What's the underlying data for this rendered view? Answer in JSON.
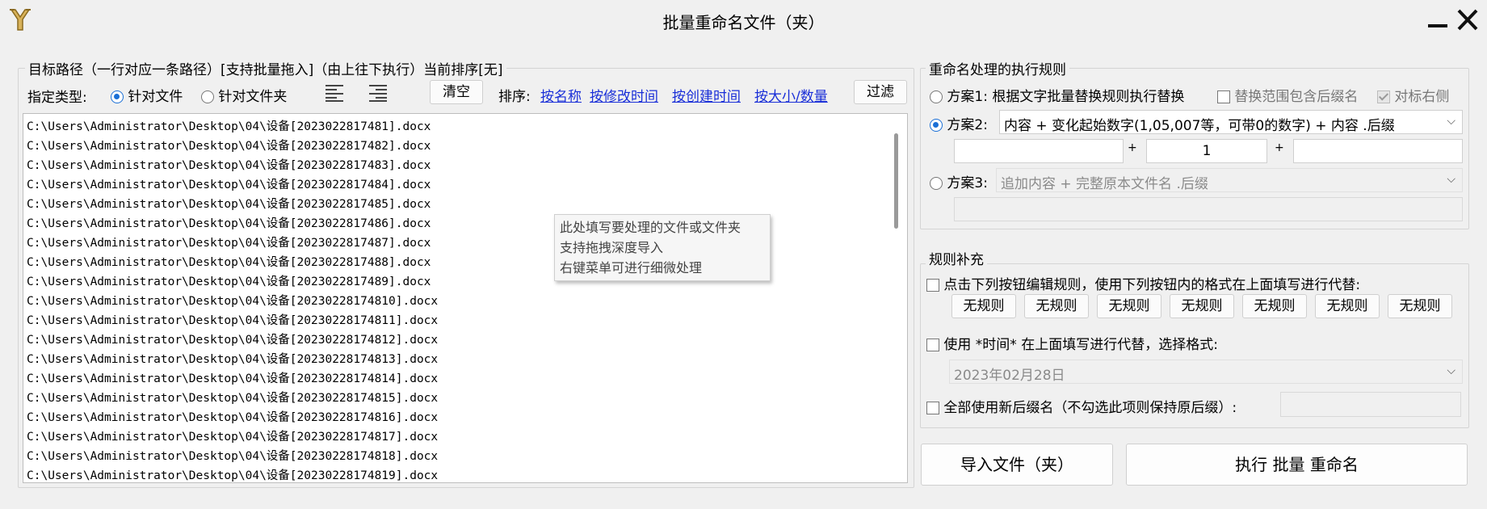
{
  "window": {
    "title": "批量重命名文件（夹）",
    "minimize_glyph": "—",
    "close_glyph": "✕"
  },
  "targets": {
    "legend": "目标路径（一行对应一条路径）[支持批量拖入]（由上往下执行）当前排序[无]",
    "type_label": "指定类型:",
    "type_file": "针对文件",
    "type_folder": "针对文件夹",
    "clear_button": "清空",
    "sort_label": "排序:",
    "sort_links": [
      "按名称",
      "按修改时间",
      "按创建时间",
      "按大小/数量"
    ],
    "filter_button": "过滤",
    "paths": [
      "C:\\Users\\Administrator\\Desktop\\04\\设备[2023022817481].docx",
      "C:\\Users\\Administrator\\Desktop\\04\\设备[2023022817482].docx",
      "C:\\Users\\Administrator\\Desktop\\04\\设备[2023022817483].docx",
      "C:\\Users\\Administrator\\Desktop\\04\\设备[2023022817484].docx",
      "C:\\Users\\Administrator\\Desktop\\04\\设备[2023022817485].docx",
      "C:\\Users\\Administrator\\Desktop\\04\\设备[2023022817486].docx",
      "C:\\Users\\Administrator\\Desktop\\04\\设备[2023022817487].docx",
      "C:\\Users\\Administrator\\Desktop\\04\\设备[2023022817488].docx",
      "C:\\Users\\Administrator\\Desktop\\04\\设备[2023022817489].docx",
      "C:\\Users\\Administrator\\Desktop\\04\\设备[20230228174810].docx",
      "C:\\Users\\Administrator\\Desktop\\04\\设备[20230228174811].docx",
      "C:\\Users\\Administrator\\Desktop\\04\\设备[20230228174812].docx",
      "C:\\Users\\Administrator\\Desktop\\04\\设备[20230228174813].docx",
      "C:\\Users\\Administrator\\Desktop\\04\\设备[20230228174814].docx",
      "C:\\Users\\Administrator\\Desktop\\04\\设备[20230228174815].docx",
      "C:\\Users\\Administrator\\Desktop\\04\\设备[20230228174816].docx",
      "C:\\Users\\Administrator\\Desktop\\04\\设备[20230228174817].docx",
      "C:\\Users\\Administrator\\Desktop\\04\\设备[20230228174818].docx",
      "C:\\Users\\Administrator\\Desktop\\04\\设备[20230228174819].docx"
    ],
    "tooltip_lines": [
      "此处填写要处理的文件或文件夹",
      "支持拖拽深度导入",
      "右键菜单可进行细微处理"
    ]
  },
  "rules": {
    "legend": "重命名处理的执行规则",
    "scheme1_label": "方案1: 根据文字批量替换规则执行替换",
    "scheme1_include_ext": "替换范围包含后缀名",
    "scheme1_align_right": "对标右侧",
    "scheme2_label": "方案2:",
    "scheme2_selected": "内容 + 变化起始数字(1,05,007等，可带0的数字) + 内容 .后缀",
    "scheme2_prefix": "",
    "scheme2_plus": "+",
    "scheme2_start_number": "1",
    "scheme2_suffix": "",
    "scheme3_label": "方案3:",
    "scheme3_selected": "追加内容 + 完整原本文件名 .后缀",
    "scheme3_value": ""
  },
  "supplement": {
    "legend": "规则补充",
    "edit_rules_label": "点击下列按钮编辑规则，使用下列按钮内的格式在上面填写进行代替:",
    "rule_buttons": [
      "无规则",
      "无规则",
      "无规则",
      "无规则",
      "无规则",
      "无规则",
      "无规则"
    ],
    "use_time_label": "使用 *时间* 在上面填写进行代替，选择格式:",
    "time_format": "2023年02月28日",
    "new_ext_label": "全部使用新后缀名（不勾选此项则保持原后缀）:",
    "new_ext_value": ""
  },
  "actions": {
    "import_button": "导入文件（夹）",
    "execute_button": "执行 批量 重命名"
  },
  "colors": {
    "accent": "#1a6fd6",
    "link": "#1a2fd8",
    "logo": "#c8a040"
  },
  "icons": {
    "logo": "pitchfork-logo-icon",
    "align_left": "align-left-icon",
    "align_right": "align-right-icon",
    "dropdown": "chevron-down-icon"
  }
}
